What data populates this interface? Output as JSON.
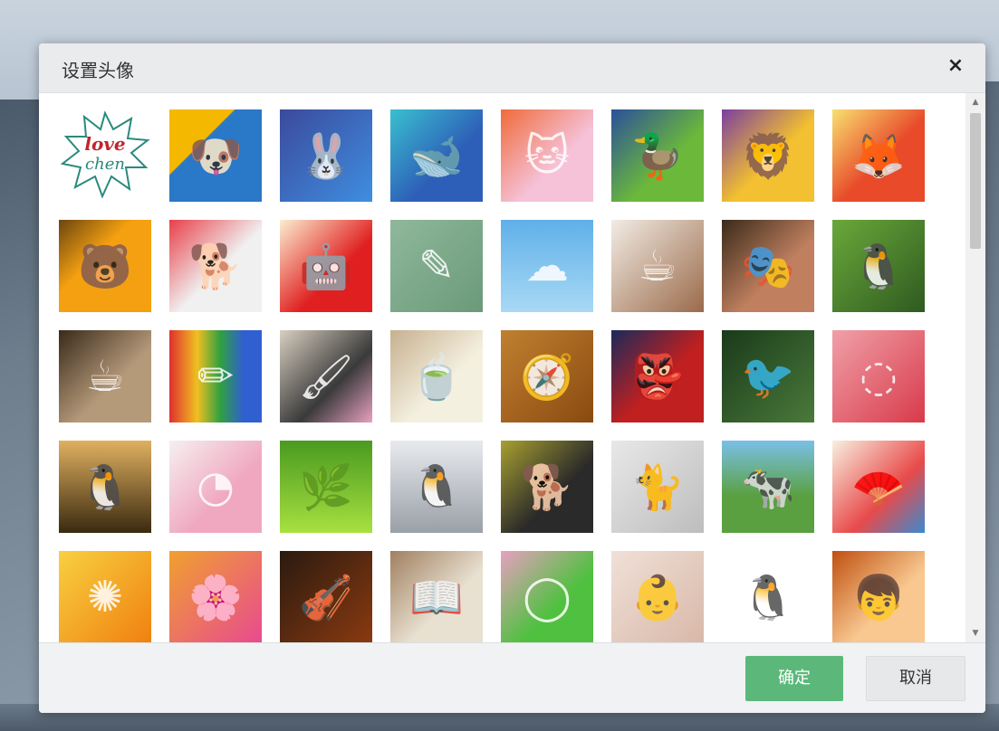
{
  "dialog": {
    "title": "设置头像",
    "close_label": "×",
    "ok_label": "确定",
    "cancel_label": "取消"
  },
  "scrollbar": {
    "up_label": "▲",
    "down_label": "▼"
  },
  "avatars": [
    {
      "name": "love-chen-avatar",
      "bg": "#ffffff",
      "glyph": ""
    },
    {
      "name": "blue-dog-avatar",
      "bg": "linear-gradient(135deg,#f5b800 0%,#f5b800 35%,#2a78c8 36%)",
      "glyph": "🐶"
    },
    {
      "name": "blue-rabbit-avatar",
      "bg": "linear-gradient(135deg,#3b4a9c 0%,#3f8ee0 100%)",
      "glyph": "🐰"
    },
    {
      "name": "blue-whale-avatar",
      "bg": "linear-gradient(135deg,#39c0d0 0%,#2e5fb8 60%)",
      "glyph": "🐋"
    },
    {
      "name": "pink-cat-avatar",
      "bg": "linear-gradient(135deg,#f06a3a 0%,#f5c2d8 60%)",
      "glyph": "🐱"
    },
    {
      "name": "green-duck-avatar",
      "bg": "linear-gradient(135deg,#2a4f9a 0%,#6bb83a 60%)",
      "glyph": "🦆"
    },
    {
      "name": "yellow-lion-avatar",
      "bg": "linear-gradient(135deg,#7b3fa0 0%,#f2c030 55%)",
      "glyph": "🦁"
    },
    {
      "name": "red-fox-avatar",
      "bg": "linear-gradient(135deg,#f8e070 0%,#e84a2a 55%)",
      "glyph": "🦊"
    },
    {
      "name": "orange-bear-avatar",
      "bg": "linear-gradient(135deg,#6b4510 0%,#f5a010 40%)",
      "glyph": "🐻"
    },
    {
      "name": "white-dog-avatar",
      "bg": "linear-gradient(135deg,#e8404a 0%,#f0f0f0 55%)",
      "glyph": "🐕"
    },
    {
      "name": "red-robot-avatar",
      "bg": "linear-gradient(135deg,#fbeed0 0%,#e02020 60%)",
      "glyph": "🤖"
    },
    {
      "name": "chalk-head-avatar",
      "bg": "linear-gradient(135deg,#8fb89a 0%,#6a9a7a 100%)",
      "glyph": "✎"
    },
    {
      "name": "sky-smile-avatar",
      "bg": "linear-gradient(180deg,#5fb0e8 0%,#a9d9f5 100%)",
      "glyph": "☁"
    },
    {
      "name": "coffee-cup-avatar",
      "bg": "linear-gradient(135deg,#f2ece4 0%,#9a6a4a 100%)",
      "glyph": "☕"
    },
    {
      "name": "opera-face-avatar",
      "bg": "linear-gradient(135deg,#3a2a1a 0%,#c08060 60%)",
      "glyph": "🎭"
    },
    {
      "name": "penguin-green-avatar",
      "bg": "linear-gradient(135deg,#6aa83a 0%,#2f5a20 100%)",
      "glyph": "🐧"
    },
    {
      "name": "latte-avatar",
      "bg": "linear-gradient(135deg,#3a2a1a 0%,#b59a7a 60%)",
      "glyph": "☕"
    },
    {
      "name": "pencils-avatar",
      "bg": "linear-gradient(90deg,#e03030 0%,#f0c020 30%,#30a040 55%,#3060d0 80%)",
      "glyph": "✏"
    },
    {
      "name": "ink-stone-avatar",
      "bg": "linear-gradient(135deg,#d8cfc0 0%,#3a3a3a 60%,#e8a0c0 100%)",
      "glyph": "🖌"
    },
    {
      "name": "tea-cup-avatar",
      "bg": "linear-gradient(135deg,#c8b090 0%,#f4f0e0 60%)",
      "glyph": "🍵"
    },
    {
      "name": "compass-avatar",
      "bg": "linear-gradient(135deg,#c08030 0%,#8a4a10 100%)",
      "glyph": "🧭"
    },
    {
      "name": "opera-mask-avatar",
      "bg": "linear-gradient(135deg,#1a2a5a 0%,#c02020 55%)",
      "glyph": "👺"
    },
    {
      "name": "hummingbird-avatar",
      "bg": "linear-gradient(135deg,#1a3a1a 0%,#4a7a3a 100%)",
      "glyph": "🐦"
    },
    {
      "name": "pink-head-avatar",
      "bg": "linear-gradient(135deg,#f0a0a8 0%,#d83a4a 100%)",
      "glyph": "◌"
    },
    {
      "name": "penguins-sunset-avatar",
      "bg": "linear-gradient(180deg,#e0b060 0%,#3a2a10 100%)",
      "glyph": "🐧"
    },
    {
      "name": "pink-paper-avatar",
      "bg": "linear-gradient(135deg,#f5f0f0 0%,#f0a8c0 60%)",
      "glyph": "◔"
    },
    {
      "name": "green-grass-avatar",
      "bg": "linear-gradient(180deg,#4a9a20 0%,#a8e040 100%)",
      "glyph": "🌿"
    },
    {
      "name": "penguin-family-avatar",
      "bg": "linear-gradient(180deg,#e8eaee 0%,#9aa0a8 100%)",
      "glyph": "🐧"
    },
    {
      "name": "husky-avatar",
      "bg": "linear-gradient(135deg,#a8a030 0%,#2a2a2a 60%)",
      "glyph": "🐕"
    },
    {
      "name": "white-cat-avatar",
      "bg": "linear-gradient(135deg,#e8e8e8 0%,#bdbdbd 100%)",
      "glyph": "🐈"
    },
    {
      "name": "meadow-avatar",
      "bg": "linear-gradient(180deg,#7ac0e8 0%,#5aa040 60%)",
      "glyph": "🐄"
    },
    {
      "name": "opera-fan-avatar",
      "bg": "linear-gradient(135deg,#f8f0e0 0%,#e84a4a 60%,#3a8ad0 100%)",
      "glyph": "🪭"
    },
    {
      "name": "orange-swirl-avatar",
      "bg": "linear-gradient(135deg,#f8d040 0%,#f08010 100%)",
      "glyph": "✺"
    },
    {
      "name": "pink-flower-avatar",
      "bg": "linear-gradient(135deg,#f0a030 0%,#e84a90 100%)",
      "glyph": "🌸"
    },
    {
      "name": "violin-avatar",
      "bg": "linear-gradient(135deg,#2a1a10 0%,#8a3a10 100%)",
      "glyph": "🎻"
    },
    {
      "name": "book-pen-avatar",
      "bg": "linear-gradient(135deg,#a08060 0%,#e8e0d0 60%)",
      "glyph": "📖"
    },
    {
      "name": "swim-rings-avatar",
      "bg": "linear-gradient(135deg,#e8a0c0 0%,#50c040 60%)",
      "glyph": "◯"
    },
    {
      "name": "baby-avatar",
      "bg": "linear-gradient(135deg,#f0e0d8 0%,#d8b8a8 100%)",
      "glyph": "👶"
    },
    {
      "name": "qq-penguin-avatar",
      "bg": "#ffffff",
      "glyph": "🐧"
    },
    {
      "name": "anime-boy-avatar",
      "bg": "linear-gradient(135deg,#c05010 0%,#f8c890 60%)",
      "glyph": "👦"
    }
  ]
}
